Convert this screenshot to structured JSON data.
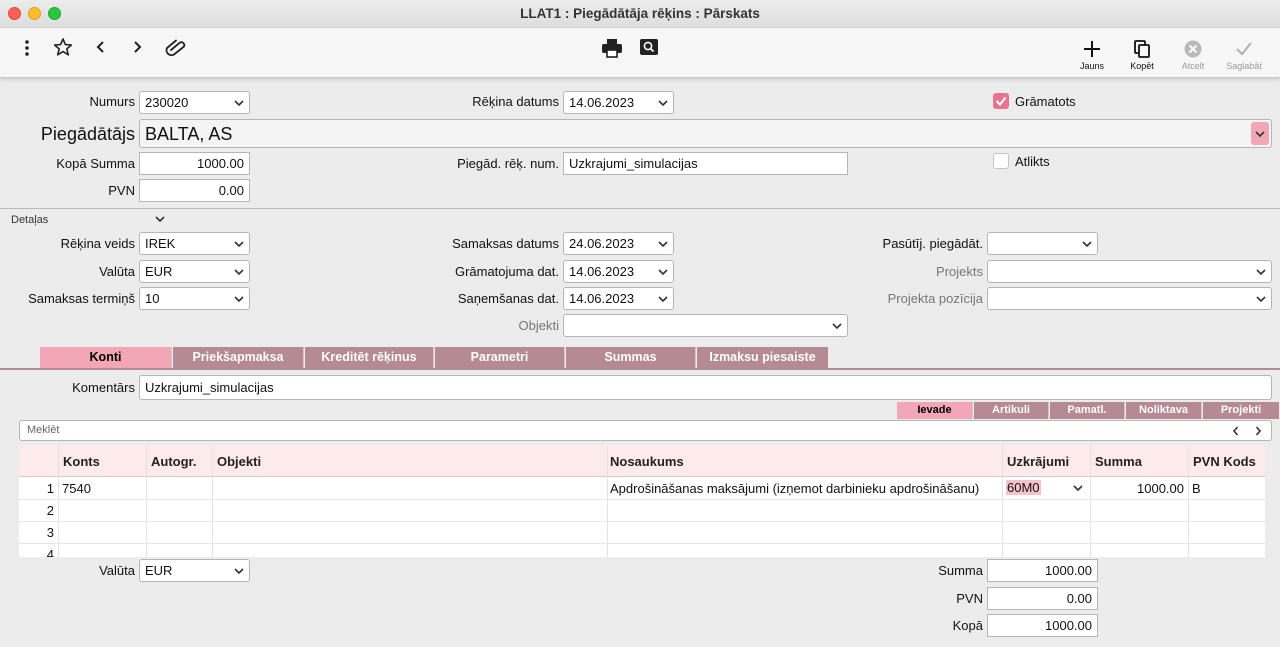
{
  "window": {
    "title": "LLAT1 : Piegādātāja rēķins : Pārskats"
  },
  "toolbar": {
    "left_icons": [
      "more-vert-icon",
      "star-icon",
      "chevron-left-icon",
      "chevron-right-icon",
      "paperclip-icon"
    ],
    "center_icons": [
      "printer-icon",
      "preview-icon"
    ],
    "new_label": "Jauns",
    "copy_label": "Kopēt",
    "cancel_label": "Atcelt",
    "save_label": "Saglabāt"
  },
  "header": {
    "number_label": "Numurs",
    "number_value": "230020",
    "invoice_date_label": "Rēķina datums",
    "invoice_date_value": "14.06.2023",
    "booked_label": "Grāmatots",
    "booked_checked": true,
    "supplier_label": "Piegādātājs",
    "supplier_value": "BALTA, AS",
    "total_label": "Kopā Summa",
    "total_value": "1000.00",
    "supp_inv_num_label": "Piegād. rēķ. num.",
    "supp_inv_num_value": "Uzkrajumi_simulacijas",
    "postponed_label": "Atlikts",
    "postponed_checked": false,
    "vat_label": "PVN",
    "vat_value": "0.00"
  },
  "details": {
    "section_label": "Detaļas",
    "invoice_type_label": "Rēķina veids",
    "invoice_type_value": "IREK",
    "currency_label": "Valūta",
    "currency_value": "EUR",
    "payment_term_label": "Samaksas termiņš",
    "payment_term_value": "10",
    "payment_date_label": "Samaksas datums",
    "payment_date_value": "24.06.2023",
    "posting_date_label": "Grāmatojuma dat.",
    "posting_date_value": "14.06.2023",
    "receipt_date_label": "Saņemšanas dat.",
    "receipt_date_value": "14.06.2023",
    "objects_label": "Objekti",
    "objects_value": "",
    "order_supplier_label": "Pasūtīj. piegādāt.",
    "order_supplier_value": "",
    "project_label": "Projekts",
    "project_value": "",
    "project_position_label": "Projekta pozīcija",
    "project_position_value": ""
  },
  "tabs": [
    "Konti",
    "Priekšapmaksa",
    "Kreditēt rēķinus",
    "Parametri",
    "Summas",
    "Izmaksu piesaiste"
  ],
  "comment": {
    "label": "Komentārs",
    "value": "Uzkrajumi_simulacijas"
  },
  "subtabs": [
    "Ievade",
    "Artikuli",
    "Pamatl.",
    "Noliktava",
    "Projekti"
  ],
  "search": {
    "placeholder": "Meklēt"
  },
  "grid": {
    "columns": [
      "Konts",
      "Autogr.",
      "Objekti",
      "Nosaukums",
      "Uzkrājumi",
      "Summa",
      "PVN Kods"
    ],
    "row_numbers": [
      "1",
      "2",
      "3",
      "4"
    ],
    "rows": [
      {
        "konts": "7540",
        "autogr": "",
        "objekti": "",
        "nosaukums": "Apdrošināšanas maksājumi (izņemot darbinieku apdrošināšanu)",
        "uzkrajumi": "60M0",
        "summa": "1000.00",
        "pvn": "B"
      }
    ]
  },
  "footer": {
    "currency_label": "Valūta",
    "currency_value": "EUR",
    "sum_label": "Summa",
    "sum_value": "1000.00",
    "vat_label": "PVN",
    "vat_value": "0.00",
    "total_label": "Kopā",
    "total_value": "1000.00"
  },
  "colors": {
    "tab_active": "#f3a6b6",
    "tab_inactive": "#b58a92",
    "grid_header": "#fdeaea",
    "checkbox": "#e8738f"
  }
}
